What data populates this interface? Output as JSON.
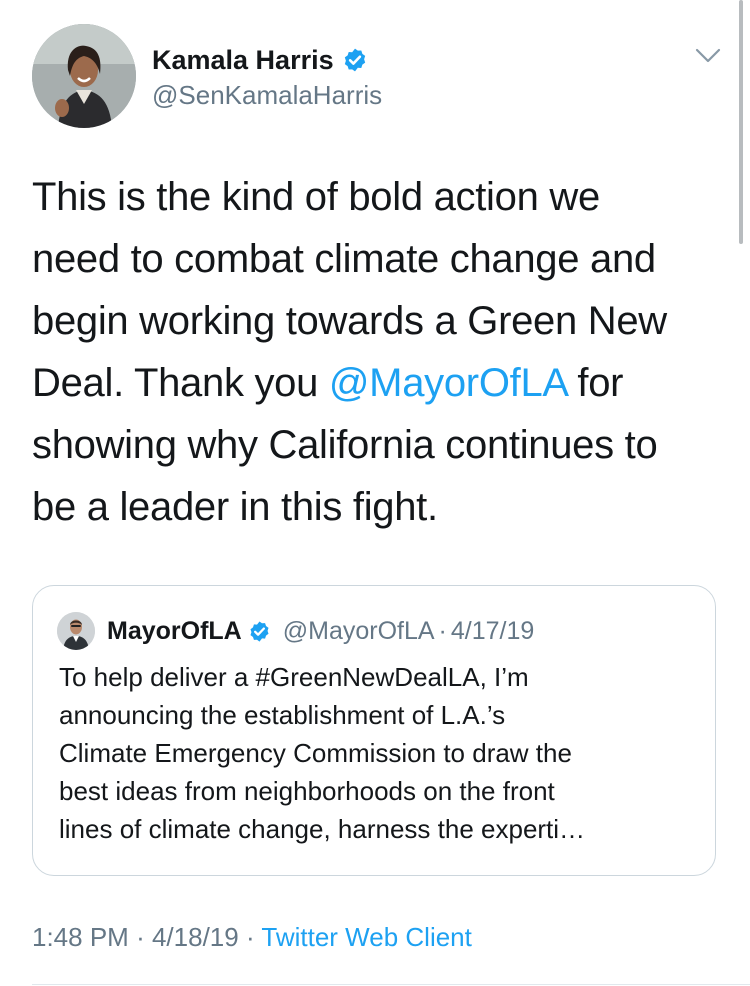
{
  "author": {
    "display_name": "Kamala Harris",
    "handle": "@SenKamalaHarris",
    "verified": true,
    "avatar_icon": "profile-photo"
  },
  "tweet": {
    "lines": [
      {
        "parts": [
          {
            "text": "This is the kind of bold action we"
          }
        ]
      },
      {
        "parts": [
          {
            "text": "need to combat climate change and"
          }
        ]
      },
      {
        "parts": [
          {
            "text": "begin working towards a Green New"
          }
        ]
      },
      {
        "parts": [
          {
            "text": "Deal. Thank you "
          },
          {
            "text": "@MayorOfLA",
            "mention": true
          },
          {
            "text": " for"
          }
        ]
      },
      {
        "parts": [
          {
            "text": "showing why California continues to"
          }
        ]
      },
      {
        "parts": [
          {
            "text": "be a leader in this fight."
          }
        ]
      }
    ]
  },
  "quoted_tweet": {
    "display_name": "MayorOfLA",
    "handle": "@MayorOfLA",
    "separator": "·",
    "date": "4/17/19",
    "verified": true,
    "lines": [
      "To help deliver a #GreenNewDealLA, I’m",
      "announcing the establishment of L.A.’s",
      "Climate Emergency Commission to draw the",
      "best ideas from neighborhoods on the front",
      "lines of climate change, harness the experti…"
    ]
  },
  "meta": {
    "time": "1:48 PM",
    "separator": "·",
    "date": "4/18/19",
    "client": "Twitter Web Client"
  },
  "colors": {
    "link": "#1da1f2",
    "secondary_text": "#657786",
    "border": "#ccd6dd"
  }
}
